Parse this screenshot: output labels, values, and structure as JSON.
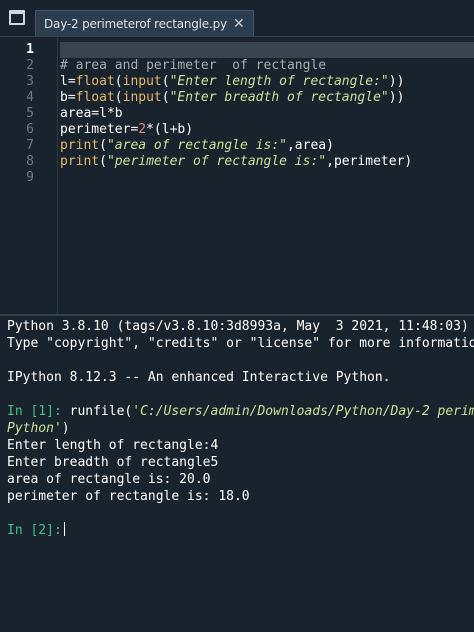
{
  "tabs": [
    {
      "label": "Day-2 perimeterof rectangle.py",
      "close_icon": "close-icon"
    }
  ],
  "editor": {
    "line_numbers": [
      "1",
      "2",
      "3",
      "4",
      "5",
      "6",
      "7",
      "8",
      "9"
    ],
    "current_line": "1",
    "lines": [
      "",
      "# area and perimeter  of rectangle",
      "l=float(input(\"Enter length of rectangle:\"))",
      "b=float(input(\"Enter breadth of rectangle\"))",
      "area=l*b",
      "perimeter=2*(l+b)",
      "print(\"area of rectangle is:\",area)",
      "print(\"perimeter of rectangle is:\",perimeter)",
      ""
    ]
  },
  "console": {
    "banner_line1": "Python 3.8.10 (tags/v3.8.10:3d8993a, May  3 2021, 11:48:03) [",
    "banner_line2": "Type \"copyright\", \"credits\" or \"license\" for more informatio",
    "ipython_line": "IPython 8.12.3 -- An enhanced Interactive Python.",
    "in1_prompt": "In [1]:",
    "in1_cmd_prefix": " runfile(",
    "in1_cmd_path1": "'C:/Users/admin/Downloads/Python/Day-2 perime",
    "in1_cmd_path2": "Python'",
    "in1_cmd_suffix": ")",
    "out_lines": [
      "Enter length of rectangle:4",
      "Enter breadth of rectangle5",
      "area of rectangle is: 20.0",
      "perimeter of rectangle is: 18.0"
    ],
    "in2_prompt": "In [2]:"
  },
  "colors": {
    "background": "#19232d",
    "tab_bg": "#2b3e50",
    "prompt_green": "#44c08d",
    "string_green": "#c9e19a",
    "builtin_orange": "#e5b86d",
    "number_red": "#e78a8a"
  }
}
